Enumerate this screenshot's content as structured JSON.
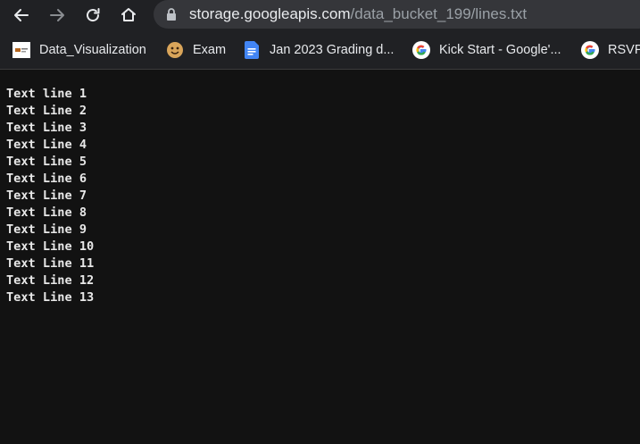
{
  "browser": {
    "url_host": "storage.googleapis.com",
    "url_path": "/data_bucket_199/lines.txt"
  },
  "bookmarks": [
    {
      "label": "Data_Visualization",
      "icon": "site-thumbnail-icon"
    },
    {
      "label": "Exam",
      "icon": "cookie-face-icon"
    },
    {
      "label": "Jan 2023 Grading d...",
      "icon": "google-docs-icon"
    },
    {
      "label": "Kick Start - Google'...",
      "icon": "google-g-icon"
    },
    {
      "label": "RSVP",
      "icon": "google-g-icon"
    }
  ],
  "document": {
    "lines": [
      "Text line 1",
      "Text Line 2",
      "Text Line 3",
      "Text Line 4",
      "Text Line 5",
      "Text Line 6",
      "Text Line 7",
      "Text Line 8",
      "Text Line 9",
      "Text Line 10",
      "Text Line 11",
      "Text Line 12",
      "Text Line 13"
    ]
  },
  "colors": {
    "page_background": "#121212",
    "toolbar_background": "#202124",
    "omnibox_background": "#35363a",
    "text": "#e8e8e8"
  }
}
